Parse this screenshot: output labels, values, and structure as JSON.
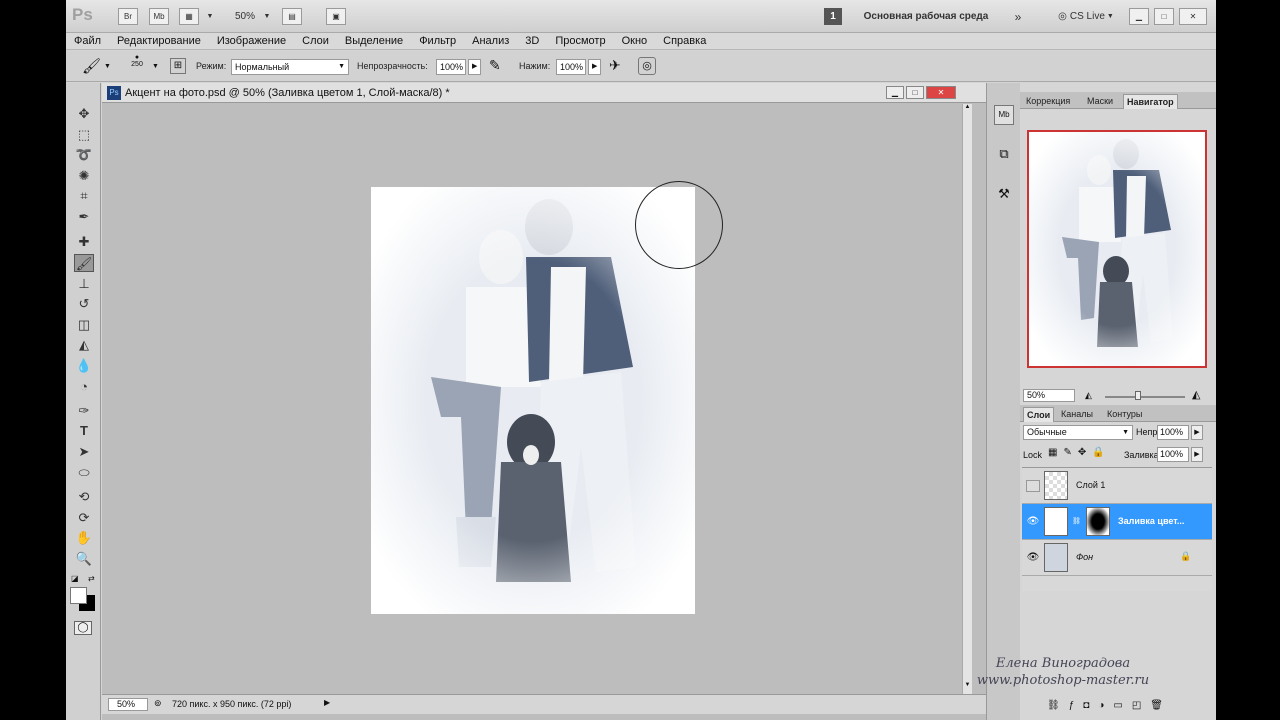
{
  "titlebar": {
    "logo": "Ps",
    "br": "Br",
    "mb": "Mb",
    "zoom": "50%",
    "workspace_num": "1",
    "workspace": "Основная рабочая среда",
    "cslive": "CS Live"
  },
  "menu": [
    "Файл",
    "Редактирование",
    "Изображение",
    "Слои",
    "Выделение",
    "Фильтр",
    "Анализ",
    "3D",
    "Просмотр",
    "Окно",
    "Справка"
  ],
  "options": {
    "brush_size": "250",
    "mode_label": "Режим:",
    "mode_value": "Нормальный",
    "opacity_label": "Непрозрачность:",
    "opacity_value": "100%",
    "flow_label": "Нажим:",
    "flow_value": "100%"
  },
  "document": {
    "title": "Акцент на фото.psd @ 50% (Заливка цветом 1, Слой-маска/8) *",
    "zoom": "50%",
    "info": "720 пикс. x 950 пикс. (72 ppi)"
  },
  "navigator": {
    "tabs": [
      "Коррекция",
      "Маски",
      "Навигатор"
    ],
    "zoom": "50%"
  },
  "layers": {
    "tabs": [
      "Слои",
      "Каналы",
      "Контуры"
    ],
    "blend": "Обычные",
    "opacity_label": "Непр",
    "opacity": "100%",
    "lock_label": "Lock",
    "fill_label": "Заливка",
    "fill": "100%",
    "items": [
      {
        "name": "Слой 1"
      },
      {
        "name": "Заливка цвет..."
      },
      {
        "name": "Фон"
      }
    ]
  },
  "signature": {
    "name": "Елена Виноградова",
    "site": "www.photoshop-master.ru"
  },
  "colors": {
    "accent": "#3399ff",
    "nav_frame": "#cc3333"
  }
}
